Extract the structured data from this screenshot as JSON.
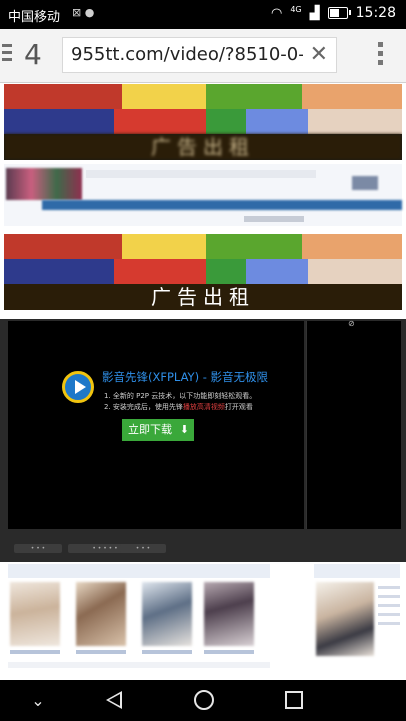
{
  "status_bar": {
    "carrier": "中国移动",
    "network": "4G",
    "time": "15:28",
    "battery_level_percent": 60
  },
  "browser": {
    "tab_count": "4",
    "url": "955tt.com/video/?8510-0-",
    "icons": {
      "menu": "hamburger-icon",
      "clear": "close-icon",
      "overflow": "more-vert-icon"
    }
  },
  "ads": {
    "banner_caption": "广告出租"
  },
  "player": {
    "app_title": "影音先锋(XFPLAY) - 影音无极限",
    "line1": "1. 全新的 P2P 云技术，以下功能即刻轻松观看。",
    "line2_prefix": "2. 安装完成后，使用先锋",
    "line2_highlight": "播放高清视频",
    "line2_suffix": "打开观看",
    "download_label": "立即下载",
    "colors": {
      "title": "#2f8fe8",
      "download_bg": "#3aa83a",
      "highlight": "#e04040"
    }
  },
  "navigation": {
    "down": "chevron-down-icon",
    "back": "back-icon",
    "home": "home-icon",
    "recent": "recent-apps-icon"
  }
}
